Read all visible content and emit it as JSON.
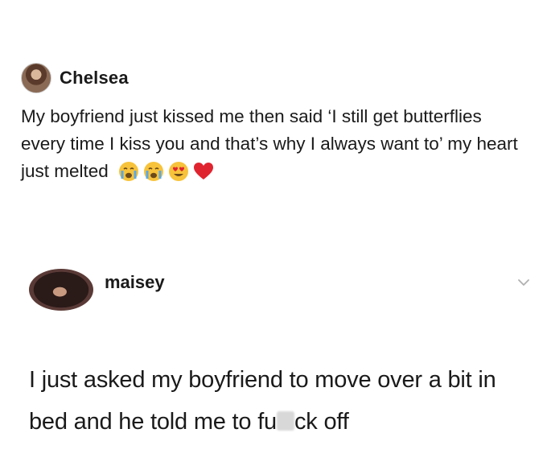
{
  "post1": {
    "username": "Chelsea",
    "text": "My boyfriend just kissed me then said ‘I still get butterflies every time I kiss you and that’s why I always want to’ my heart just melted",
    "emojis": [
      "crying-face-icon",
      "crying-face-icon",
      "heart-eyes-icon",
      "red-heart-icon"
    ]
  },
  "post2": {
    "username": "maisey",
    "text_before": "I just asked my boyfriend to move over a bit in bed and he told me to fu",
    "text_after": "ck off"
  },
  "colors": {
    "text": "#1a1a1a",
    "chevron": "#b0b0b0",
    "emoji_yellow": "#f7c33b",
    "tear_blue": "#59a8e8",
    "heart_red": "#e0242f"
  }
}
